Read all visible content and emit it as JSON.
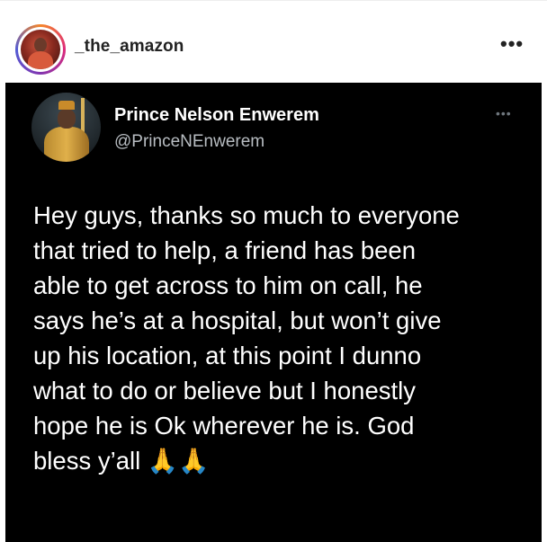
{
  "instagram_post": {
    "username": "_the_amazon",
    "more_icon": "•••"
  },
  "tweet": {
    "display_name": "Prince Nelson Enwerem",
    "handle": "@PrinceNEnwerem",
    "more_icon": "•••",
    "text": "Hey guys, thanks so much to everyone\nthat tried to help, a friend has been\nable to get across to him on call, he\nsays he’s at a hospital, but won’t give\nup his location, at this point I dunno\nwhat to do or believe but I honestly\nhope he is Ok wherever he is. God\nbless y’all 🙏🙏"
  },
  "colors": {
    "tweet_background": "#000000",
    "tweet_text": "#ffffff",
    "tweet_handle": "#b8bdc2",
    "ig_username": "#222222"
  }
}
